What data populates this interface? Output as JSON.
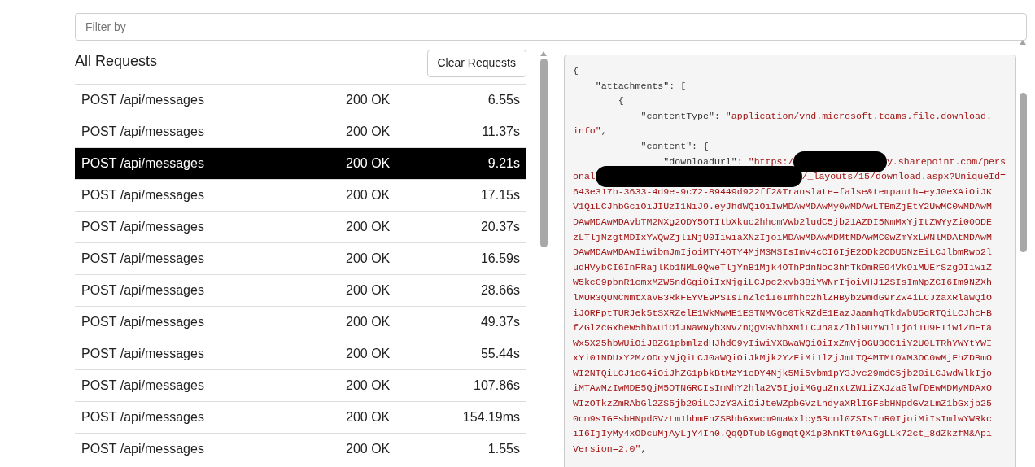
{
  "filter": {
    "placeholder": "Filter by"
  },
  "requests_panel": {
    "title": "All Requests",
    "clear_button": "Clear Requests"
  },
  "requests": [
    {
      "method_path": "POST /api/messages",
      "status": "200 OK",
      "duration": "6.55s",
      "selected": false
    },
    {
      "method_path": "POST /api/messages",
      "status": "200 OK",
      "duration": "11.37s",
      "selected": false
    },
    {
      "method_path": "POST /api/messages",
      "status": "200 OK",
      "duration": "9.21s",
      "selected": true
    },
    {
      "method_path": "POST /api/messages",
      "status": "200 OK",
      "duration": "17.15s",
      "selected": false
    },
    {
      "method_path": "POST /api/messages",
      "status": "200 OK",
      "duration": "20.37s",
      "selected": false
    },
    {
      "method_path": "POST /api/messages",
      "status": "200 OK",
      "duration": "16.59s",
      "selected": false
    },
    {
      "method_path": "POST /api/messages",
      "status": "200 OK",
      "duration": "28.66s",
      "selected": false
    },
    {
      "method_path": "POST /api/messages",
      "status": "200 OK",
      "duration": "49.37s",
      "selected": false
    },
    {
      "method_path": "POST /api/messages",
      "status": "200 OK",
      "duration": "55.44s",
      "selected": false
    },
    {
      "method_path": "POST /api/messages",
      "status": "200 OK",
      "duration": "107.86s",
      "selected": false
    },
    {
      "method_path": "POST /api/messages",
      "status": "200 OK",
      "duration": "154.19ms",
      "selected": false
    },
    {
      "method_path": "POST /api/messages",
      "status": "200 OK",
      "duration": "1.55s",
      "selected": false
    }
  ],
  "code_lines": [
    [
      {
        "kind": "punct",
        "text": "{"
      }
    ],
    [
      {
        "kind": "key",
        "text": "    \"attachments\""
      },
      {
        "kind": "punct",
        "text": ": ["
      }
    ],
    [
      {
        "kind": "punct",
        "text": "        {"
      }
    ],
    [
      {
        "kind": "key",
        "text": "            \"contentType\""
      },
      {
        "kind": "punct",
        "text": ": "
      },
      {
        "kind": "string",
        "text": "\"application/vnd.microsoft.teams.file.download."
      }
    ],
    [
      {
        "kind": "string",
        "text": "info\""
      },
      {
        "kind": "punct",
        "text": ","
      }
    ],
    [
      {
        "kind": "key",
        "text": "            \"content\""
      },
      {
        "kind": "punct",
        "text": ": {"
      }
    ],
    [
      {
        "kind": "key",
        "text": "                \"downloadUrl\""
      },
      {
        "kind": "punct",
        "text": ": "
      },
      {
        "kind": "string",
        "text": "\"https:/"
      },
      {
        "kind": "redaction"
      },
      {
        "kind": "string",
        "text": "y.sharepoint.com/pers"
      }
    ],
    [
      {
        "kind": "string",
        "text": "onal"
      },
      {
        "kind": "redaction"
      },
      {
        "kind": "string",
        "text": "/_layouts/15/download.aspx?UniqueId="
      }
    ],
    [
      {
        "kind": "string",
        "text": "643e317b-3633-4d9e-9c72-89449d922ff2&Translate=false&tempauth=eyJ0eXAiOiJK"
      }
    ],
    [
      {
        "kind": "string",
        "text": "V1QiLCJhbGciOiJIUzI1NiJ9.eyJhdWQiOiIwMDAwMDAwMy0wMDAwLTBmZjEtY2UwMC0wMDAwM"
      }
    ],
    [
      {
        "kind": "string",
        "text": "DAwMDAwMDAvbTM2NXg2ODY5OTItbXkuc2hhcmVwb2ludC5jb21AZDI5NmMxYjItZWYyZi00ODE"
      }
    ],
    [
      {
        "kind": "string",
        "text": "zLTljNzgtMDIxYWQwZjliNjU0IiwiaXNzIjoiMDAwMDAwMDMtMDAwMC0wZmYxLWNlMDAtMDAwM"
      }
    ],
    [
      {
        "kind": "string",
        "text": "DAwMDAwMDAwIiwibmJmIjoiMTY4OTY4MjM3MSIsImV4cCI6IjE2ODk2ODU5NzEiLCJlbmRwb2l"
      }
    ],
    [
      {
        "kind": "string",
        "text": "udHVybCI6InFRajlKb1NML0QweTljYnB1Mjk4OThPdnNoc3hhTk9mRE94Vk9iMUErSzg9IiwiZ"
      }
    ],
    [
      {
        "kind": "string",
        "text": "W5kcG9pbnR1cmxMZW5ndGgiOiIxNjgiLCJpc2xvb3BiYWNrIjoiVHJ1ZSIsImNpZCI6Im9NZXh"
      }
    ],
    [
      {
        "kind": "string",
        "text": "lMUR3QUNCNmtXaVB3RkFEYVE9PSIsInZlciI6Imhhc2hlZHByb29mdG9rZW4iLCJzaXRlaWQiO"
      }
    ],
    [
      {
        "kind": "string",
        "text": "iJORFptTURJek5tSXRZelE1WkMwME1ESTNMVGc0TkRZdE1EazJaamhqTkdWbU5qRTQiLCJhcHB"
      }
    ],
    [
      {
        "kind": "string",
        "text": "fZGlzcGxheW5hbWUiOiJNaWNyb3NvZnQgVGVhbXMiLCJnaXZlbl9uYW1lIjoiTU9EIiwiZmFta"
      }
    ],
    [
      {
        "kind": "string",
        "text": "Wx5X25hbWUiOiJBZG1pbmlzdHJhdG9yIiwiYXBwaWQiOiIxZmVjOGU3OC1iY2U0LTRhYWYtYWI"
      }
    ],
    [
      {
        "kind": "string",
        "text": "xYi01NDUxY2MzODcyNjQiLCJ0aWQiOiJkMjk2YzFiMi1lZjJmLTQ4MTMtOWM3OC0wMjFhZDBmO"
      }
    ],
    [
      {
        "kind": "string",
        "text": "WI2NTQiLCJ1cG4iOiJhZG1pbkBtMzY1eDY4Njk5Mi5vbm1pY3Jvc29mdC5jb20iLCJwdWlkIjo"
      }
    ],
    [
      {
        "kind": "string",
        "text": "iMTAwMzIwMDE5QjM5OTNGRCIsImNhY2hla2V5IjoiMGguZnxtZW1iZXJzaGlwfDEwMDMyMDAxO"
      }
    ],
    [
      {
        "kind": "string",
        "text": "WIzOTkzZmRAbGl2ZS5jb20iLCJzY3AiOiJteWZpbGVzLndyaXRlIGFsbHNpdGVzLmZ1bGxjb25"
      }
    ],
    [
      {
        "kind": "string",
        "text": "0cm9sIGFsbHNpdGVzLm1hbmFnZSBhbGxwcm9maWxlcy53cml0ZSIsInR0IjoiMiIsImlwYWRkc"
      }
    ],
    [
      {
        "kind": "string",
        "text": "iI6IjIyMy4xODcuMjAyLjY4In0.QqQDTublGgmqtQX1p3NmKTt0AiGgLLk72ct_8dZkzfM&Api"
      }
    ],
    [
      {
        "kind": "string",
        "text": "Version=2.0\""
      },
      {
        "kind": "punct",
        "text": ","
      }
    ]
  ]
}
